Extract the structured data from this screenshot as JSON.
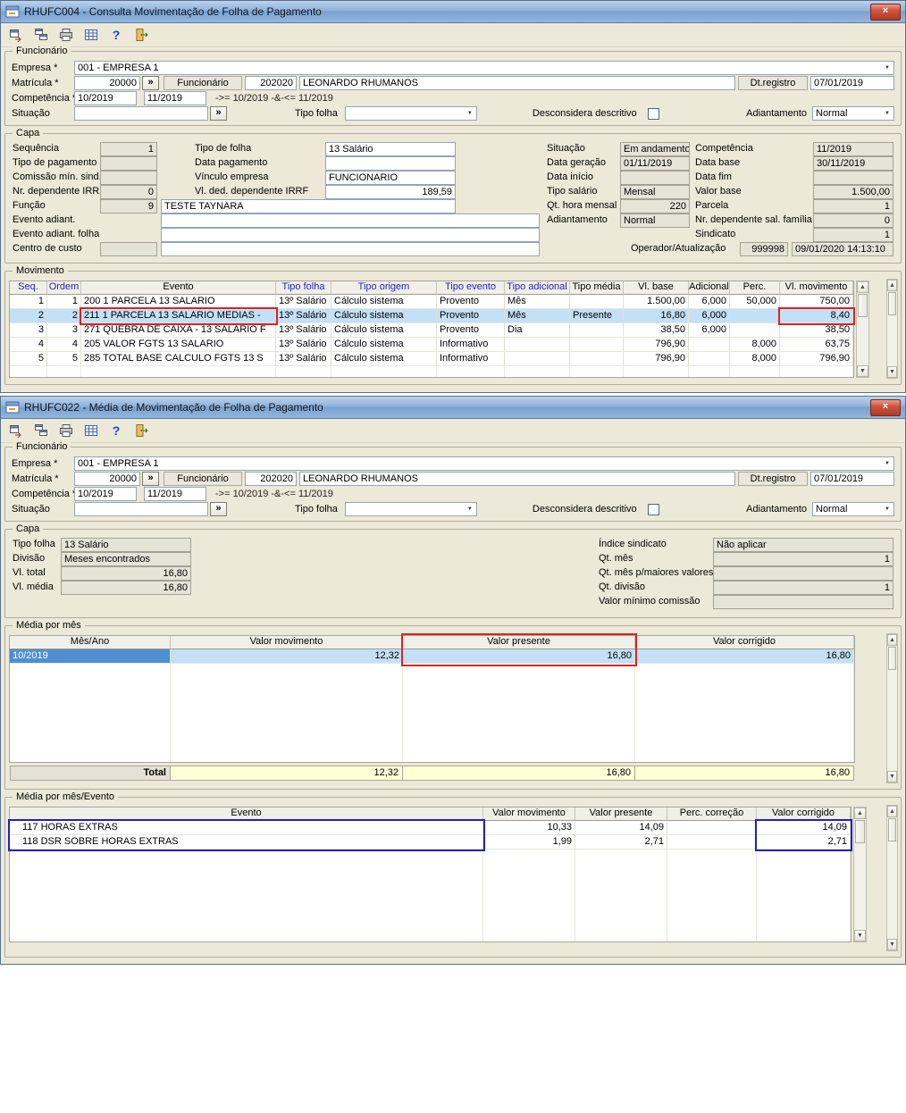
{
  "icons": {
    "close": "×",
    "dropdown": "▼",
    "more_button": "»",
    "help": "?",
    "scroll_up": "▲",
    "scroll_down": "▼"
  },
  "colors": {
    "titlebar_blue": "#7AA2CF",
    "selection_row": "#C3E0F6",
    "selection_cell": "#4D8FD1",
    "annotation_red": "#E02020",
    "annotation_blue": "#2020C0",
    "total_row_bg": "#FFFFD6",
    "header_link_blue": "#2222CC"
  },
  "win1": {
    "title": "RHUFC004 - Consulta Movimentação de Folha de Pagamento",
    "funcionario": {
      "legend": "Funcionário",
      "empresa_label": "Empresa *",
      "empresa_value": "001 - EMPRESA 1",
      "matricula_label": "Matrícula *",
      "matricula_value": "20000",
      "funcionario_label": "Funcionário",
      "funcionario_code": "202020",
      "funcionario_name": "LEONARDO RHUMANOS",
      "dt_registro_label": "Dt.registro",
      "dt_registro_value": "07/01/2019",
      "competencia_label": "Competência *",
      "competencia_inicial": "10/2019",
      "competencia_final": "11/2019",
      "competencia_hint": "->= 10/2019 -&-<= 11/2019",
      "situacao_label": "Situação",
      "situacao_value": "",
      "tipo_folha_label": "Tipo folha",
      "tipo_folha_value": "",
      "desconsidera_descritivo_label": "Desconsidera descritivo",
      "adiantamento_label": "Adiantamento",
      "adiantamento_value": "Normal"
    },
    "capa": {
      "legend": "Capa",
      "sequencia_label": "Sequência",
      "sequencia_value": "1",
      "tipo_pagamento_label": "Tipo de pagamento",
      "tipo_pagamento_value": "",
      "comissao_label": "Comissão mín. sind.",
      "comissao_value": "",
      "nr_dep_irrf_label": "Nr. dependente IRRF",
      "nr_dep_irrf_value": "0",
      "funcao_label": "Função",
      "funcao_value": "9",
      "funcao_desc": "TESTE TAYNARA",
      "evento_adiant_label": "Evento adiant.",
      "evento_adiant_value": "",
      "evento_adiant_folha_label": "Evento adiant. folha",
      "evento_adiant_folha_value": "",
      "centro_custo_label": "Centro de custo",
      "centro_custo_value": "",
      "centro_custo_desc": "",
      "tipo_de_folha_label": "Tipo de folha",
      "tipo_de_folha_value": "13 Salário",
      "data_pagamento_label": "Data pagamento",
      "data_pagamento_value": "",
      "vinculo_label": "Vínculo empresa",
      "vinculo_value": "FUNCIONARIO",
      "vl_ded_label": "Vl. ded. dependente IRRF",
      "vl_ded_value": "189,59",
      "situacao_label": "Situação",
      "situacao_value": "Em andamento",
      "data_geracao_label": "Data geração",
      "data_geracao_value": "01/11/2019",
      "data_inicio_label": "Data início",
      "data_inicio_value": "",
      "tipo_salario_label": "Tipo salário",
      "tipo_salario_value": "Mensal",
      "qt_hora_label": "Qt. hora mensal",
      "qt_hora_value": "220",
      "adiantamento_label": "Adiantamento",
      "adiantamento_value": "Normal",
      "competencia_label": "Competência",
      "competencia_value": "11/2019",
      "data_base_label": "Data base",
      "data_base_value": "30/11/2019",
      "data_fim_label": "Data fim",
      "data_fim_value": "",
      "valor_base_label": "Valor base",
      "valor_base_value": "1.500,00",
      "parcela_label": "Parcela",
      "parcela_value": "1",
      "nr_dep_sal_label": "Nr. dependente sal. família",
      "nr_dep_sal_value": "0",
      "sindicato_label": "Sindicato",
      "sindicato_value": "1",
      "operador_label": "Operador/Atualização",
      "operador_value": "999998",
      "atualizacao_value": "09/01/2020 14:13:10"
    },
    "movimento": {
      "legend": "Movimento",
      "headers": [
        "Seq.",
        "Ordem",
        "Evento",
        "Tipo folha",
        "Tipo origem",
        "Tipo evento",
        "Tipo adicional",
        "Tipo média",
        "Vl. base",
        "Adicional",
        "Perc.",
        "Vl. movimento"
      ],
      "rows": [
        [
          "1",
          "1",
          "200 1 PARCELA 13 SALARIO",
          "13º Salário",
          "Cálculo sistema",
          "Provento",
          "Mês",
          "",
          "1.500,00",
          "6,000",
          "50,000",
          "750,00"
        ],
        [
          "2",
          "2",
          "211 1 PARCELA 13 SALARIO MEDIAS -",
          "13º Salário",
          "Cálculo sistema",
          "Provento",
          "Mês",
          "Presente",
          "16,80",
          "6,000",
          "",
          "8,40"
        ],
        [
          "3",
          "3",
          "271 QUEBRA DE CAIXA - 13 SALARIO F",
          "13º Salário",
          "Cálculo sistema",
          "Provento",
          "Dia",
          "",
          "38,50",
          "6,000",
          "",
          "38,50"
        ],
        [
          "4",
          "4",
          "205 VALOR FGTS 13 SALARIO",
          "13º Salário",
          "Cálculo sistema",
          "Informativo",
          "",
          "",
          "796,90",
          "",
          "8,000",
          "63,75"
        ],
        [
          "5",
          "5",
          "285 TOTAL BASE CALCULO FGTS 13 S",
          "13º Salário",
          "Cálculo sistema",
          "Informativo",
          "",
          "",
          "796,90",
          "",
          "8,000",
          "796,90"
        ]
      ]
    }
  },
  "win2": {
    "title": "RHUFC022 - Média de Movimentação de Folha de Pagamento",
    "funcionario": {
      "legend": "Funcionário",
      "empresa_label": "Empresa *",
      "empresa_value": "001 - EMPRESA 1",
      "matricula_label": "Matrícula *",
      "matricula_value": "20000",
      "funcionario_label": "Funcionário",
      "funcionario_code": "202020",
      "funcionario_name": "LEONARDO RHUMANOS",
      "dt_registro_label": "Dt.registro",
      "dt_registro_value": "07/01/2019",
      "competencia_label": "Competência *",
      "competencia_inicial": "10/2019",
      "competencia_final": "11/2019",
      "competencia_hint": "->= 10/2019 -&-<= 11/2019",
      "situacao_label": "Situação",
      "situacao_value": "",
      "tipo_folha_label": "Tipo folha",
      "tipo_folha_value": "",
      "desconsidera_descritivo_label": "Desconsidera descritivo",
      "adiantamento_label": "Adiantamento",
      "adiantamento_value": "Normal"
    },
    "capa": {
      "legend": "Capa",
      "tipo_folha_label": "Tipo folha",
      "tipo_folha_value": "13 Salário",
      "divisao_label": "Divisão",
      "divisao_value": "Meses encontrados",
      "vl_total_label": "Vl. total",
      "vl_total_value": "16,80",
      "vl_media_label": "Vl. média",
      "vl_media_value": "16,80",
      "indice_label": "Índice sindicato",
      "indice_value": "Não aplicar",
      "qt_mes_label": "Qt. mês",
      "qt_mes_value": "1",
      "qt_mes_maiores_label": "Qt. mês p/maiores valores",
      "qt_mes_maiores_value": "",
      "qt_divisao_label": "Qt. divisão",
      "qt_divisao_value": "1",
      "valor_min_label": "Valor mínimo comissão",
      "valor_min_value": ""
    },
    "media_mes": {
      "legend": "Média por mês",
      "headers": [
        "Mês/Ano",
        "Valor movimento",
        "Valor presente",
        "Valor corrigido"
      ],
      "rows": [
        [
          "10/2019",
          "12,32",
          "16,80",
          "16,80"
        ]
      ],
      "total_label": "Total",
      "total": [
        "12,32",
        "16,80",
        "16,80"
      ]
    },
    "media_evento": {
      "legend": "Média por mês/Evento",
      "headers": [
        "Evento",
        "Valor movimento",
        "Valor presente",
        "Perc. correção",
        "Valor corrigido"
      ],
      "rows": [
        [
          "117 HORAS EXTRAS",
          "10,33",
          "14,09",
          "",
          "14,09"
        ],
        [
          "118 DSR SOBRE HORAS EXTRAS",
          "1,99",
          "2,71",
          "",
          "2,71"
        ]
      ]
    }
  }
}
